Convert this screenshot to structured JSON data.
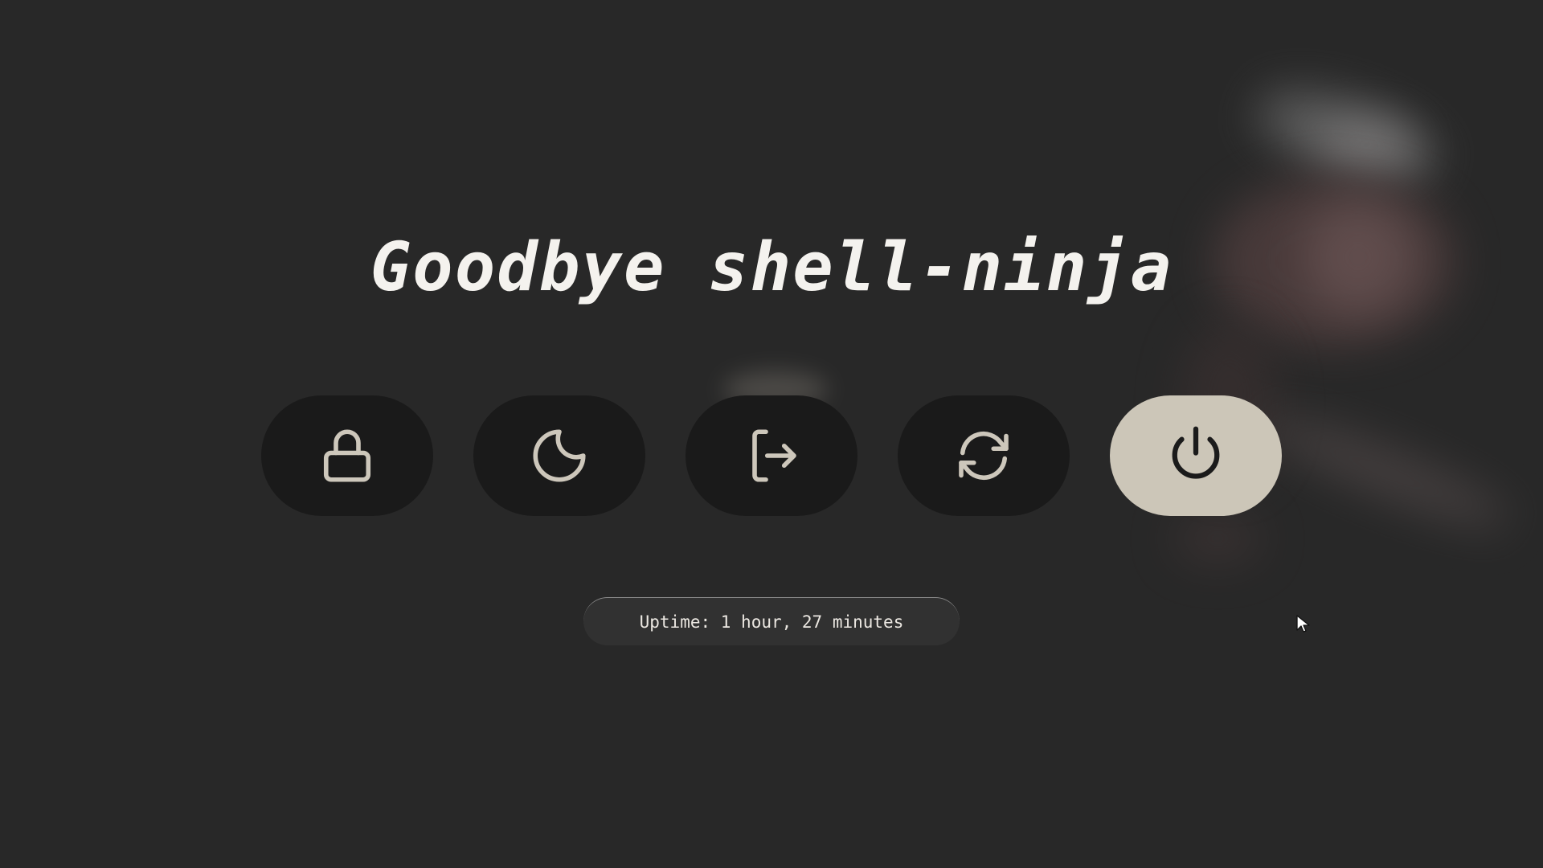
{
  "greeting": "Goodbye shell-ninja",
  "actions": [
    {
      "id": "lock",
      "icon": "lock-icon"
    },
    {
      "id": "suspend",
      "icon": "moon-icon"
    },
    {
      "id": "logout",
      "icon": "logout-icon"
    },
    {
      "id": "reboot",
      "icon": "refresh-icon"
    },
    {
      "id": "shutdown",
      "icon": "power-icon",
      "selected": true
    }
  ],
  "uptime": "Uptime: 1 hour, 27 minutes",
  "colors": {
    "background": "#282828",
    "button": "#1a1a1a",
    "button_active": "#ccc6b8",
    "icon": "#cdc7bb",
    "text": "#f4f2ee"
  }
}
